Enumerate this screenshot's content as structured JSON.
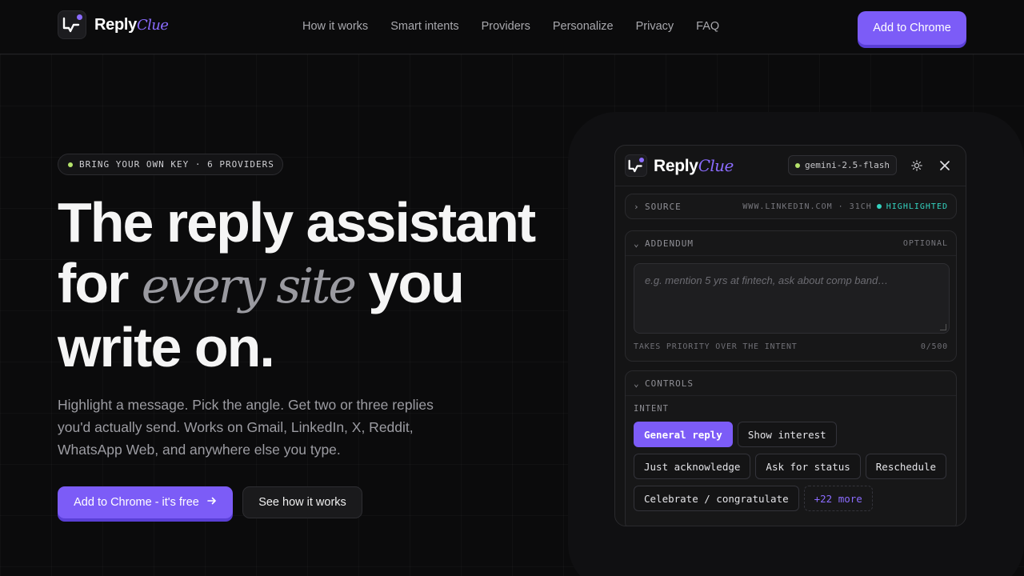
{
  "brand": {
    "name": "Reply",
    "accent": "Clue",
    "accent_color": "#7c5cf7"
  },
  "nav": {
    "links": [
      "How it works",
      "Smart intents",
      "Providers",
      "Personalize",
      "Privacy",
      "FAQ"
    ],
    "cta": "Add to Chrome"
  },
  "hero": {
    "badge": "BRING YOUR OWN KEY · 6 PROVIDERS",
    "headline_line1": "The reply assistant",
    "headline_for": "for",
    "headline_italic": "every site",
    "headline_you": "you",
    "headline_line3": "write on.",
    "subcopy": "Highlight a message. Pick the angle. Get two or three replies you'd actually send. Works on Gmail, LinkedIn, X, Reddit, WhatsApp Web, and anywhere else you type.",
    "primary_button": "Add to Chrome - it's free",
    "secondary_button": "See how it works"
  },
  "panel": {
    "model": "gemini-2.5-flash",
    "source": {
      "label": "SOURCE",
      "meta": "WWW.LINKEDIN.COM · 31CH",
      "status": "HIGHLIGHTED"
    },
    "addendum": {
      "label": "ADDENDUM",
      "optional": "OPTIONAL",
      "placeholder": "e.g. mention 5 yrs at fintech, ask about comp band…",
      "hint": "TAKES PRIORITY OVER THE INTENT",
      "counter": "0/500"
    },
    "controls": {
      "label": "CONTROLS",
      "intent_label": "INTENT",
      "chips": [
        "General reply",
        "Show interest",
        "Just acknowledge",
        "Ask for status",
        "Reschedule",
        "Celebrate / congratulate"
      ],
      "active_chip": "General reply",
      "more": "+22 more"
    }
  }
}
